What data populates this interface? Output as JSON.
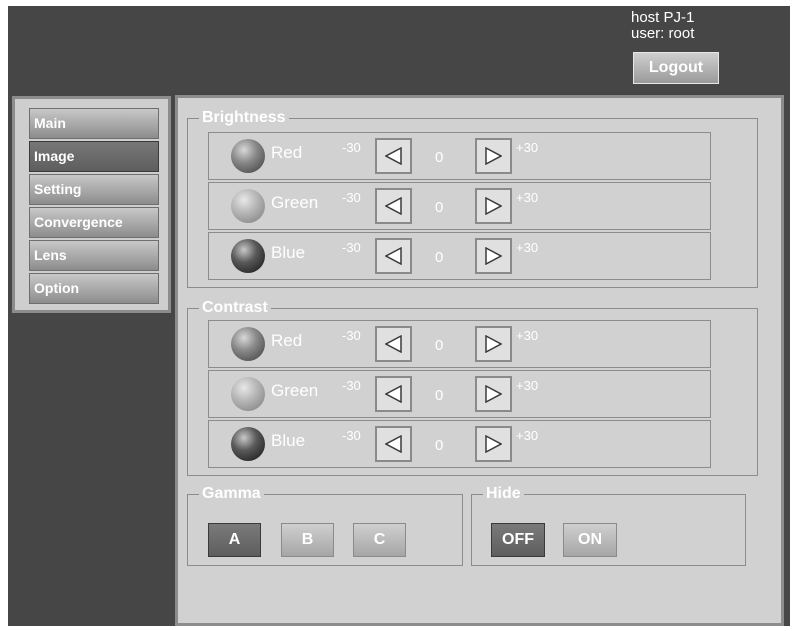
{
  "header": {
    "host_text": "host PJ-1",
    "user_text": "user: root",
    "logout_label": "Logout"
  },
  "sidebar": {
    "items": [
      {
        "label": "Main"
      },
      {
        "label": "Image"
      },
      {
        "label": "Setting"
      },
      {
        "label": "Convergence"
      },
      {
        "label": "Lens"
      },
      {
        "label": "Option"
      }
    ],
    "active": "Image"
  },
  "brightness": {
    "title": "Brightness",
    "rows": [
      {
        "name": "Red",
        "min": "-30",
        "value": "0",
        "max": "+30"
      },
      {
        "name": "Green",
        "min": "-30",
        "value": "0",
        "max": "+30"
      },
      {
        "name": "Blue",
        "min": "-30",
        "value": "0",
        "max": "+30"
      }
    ]
  },
  "contrast": {
    "title": "Contrast",
    "rows": [
      {
        "name": "Red",
        "min": "-30",
        "value": "0",
        "max": "+30"
      },
      {
        "name": "Green",
        "min": "-30",
        "value": "0",
        "max": "+30"
      },
      {
        "name": "Blue",
        "min": "-30",
        "value": "0",
        "max": "+30"
      }
    ]
  },
  "gamma": {
    "title": "Gamma",
    "options": [
      "A",
      "B",
      "C"
    ],
    "selected": "A"
  },
  "hide": {
    "title": "Hide",
    "options": [
      "OFF",
      "ON"
    ],
    "selected": "OFF"
  },
  "icons": {
    "left": "triangle-left-icon",
    "right": "triangle-right-icon",
    "red_indicator": "sphere-icon",
    "green_indicator": "sphere-icon",
    "blue_indicator": "sphere-icon"
  },
  "colors": {
    "background": "#464646",
    "panel": "#d1d1d1",
    "active_button": "#6a6a6a",
    "text": "#ffffff"
  }
}
